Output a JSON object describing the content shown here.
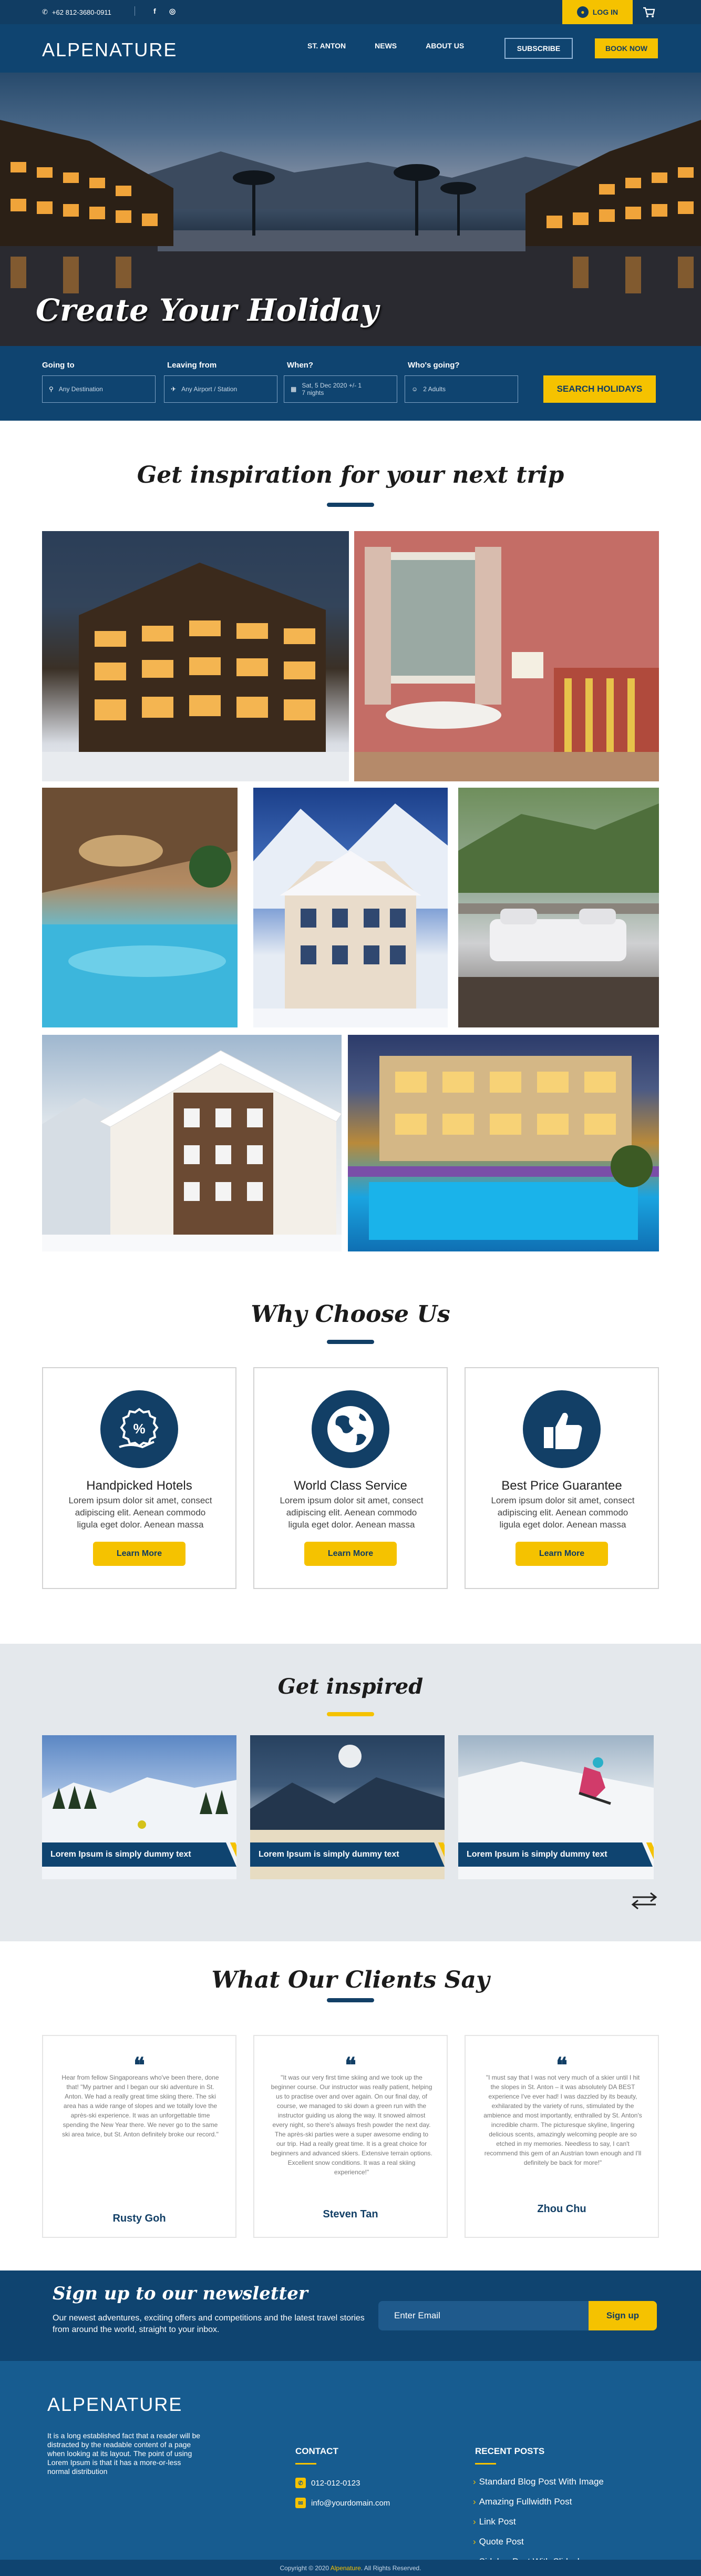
{
  "topbar": {
    "phone": "+62 812-3680-0911",
    "social": [
      "facebook-icon",
      "instagram-icon"
    ],
    "login_label": "LOG IN"
  },
  "header": {
    "logo": "ALPENATURE",
    "nav": [
      "ST. ANTON",
      "NEWS",
      "ABOUT US"
    ],
    "subscribe_label": "SUBSCRIBE",
    "book_label": "BOOK NOW"
  },
  "hero": {
    "title": "Create Your Holiday"
  },
  "search": {
    "going_to": {
      "label": "Going to",
      "placeholder": "Any Destination"
    },
    "leaving_from": {
      "label": "Leaving from",
      "placeholder": "Any Airport / Station"
    },
    "when": {
      "label": "When?",
      "line1": "Sat, 5 Dec 2020 +/- 1",
      "line2": "7 nights"
    },
    "who": {
      "label": "Who's going?",
      "value": "2 Adults"
    },
    "button": "SEARCH HOLIDAYS"
  },
  "inspiration": {
    "title": "Get inspiration for your next trip"
  },
  "why": {
    "title": "Why Choose Us",
    "cards": [
      {
        "title": "Handpicked Hotels",
        "text": "Lorem ipsum dolor sit amet, consect adipiscing elit. Aenean commodo ligula eget dolor. Aenean massa",
        "button": "Learn More",
        "icon": "percent-hand-icon"
      },
      {
        "title": "World Class Service",
        "text": "Lorem ipsum dolor sit amet, consect adipiscing elit. Aenean commodo ligula eget dolor. Aenean massa",
        "button": "Learn More",
        "icon": "globe-icon"
      },
      {
        "title": "Best Price Guarantee",
        "text": "Lorem ipsum dolor sit amet, consect adipiscing elit. Aenean commodo ligula eget dolor. Aenean massa",
        "button": "Learn More",
        "icon": "thumbs-up-icon"
      }
    ]
  },
  "inspired": {
    "title": "Get inspired",
    "cards": [
      {
        "caption": "Lorem Ipsum is simply dummy text"
      },
      {
        "caption": "Lorem Ipsum is simply dummy text"
      },
      {
        "caption": "Lorem Ipsum is simply dummy text"
      }
    ]
  },
  "testimonials": {
    "title": "What Our Clients Say",
    "items": [
      {
        "text": "Hear from fellow Singaporeans who've been there, done that! \"My partner and I began our ski adventure in St. Anton. We had a really great time skiing there. The ski area has a wide range of slopes and we totally love the après-ski experience. It was an unforgettable time spending the New Year there. We never go to the same ski area twice, but St. Anton definitely broke our record.\"",
        "name": "Rusty Goh"
      },
      {
        "text": "\"It was our very first time skiing and we took up the beginner course. Our instructor was really patient, helping us to practise over and over again. On our final day, of course, we managed to ski down a green run with the instructor guiding us along the way. It snowed almost every night, so there's always fresh powder the next day. The après-ski parties were a super awesome ending to our trip. Had a really great time. It is a great choice for beginners and advanced skiers. Extensive terrain options. Excellent snow conditions. It was a real skiing experience!\"",
        "name": "Steven Tan"
      },
      {
        "text": "\"I must say that I was not very much of a skier until I hit the slopes in St. Anton – it was absolutely DA BEST experience I've ever had! I was dazzled by its beauty, exhilarated by the variety of runs, stimulated by the ambience and most importantly, enthralled by St. Anton's incredible charm. The picturesque skyline, lingering delicious scents, amazingly welcoming people are so etched in my memories. Needless to say, I can't recommend this gem of an Austrian town enough and I'll definitely be back for more!\"",
        "name": "Zhou Chu"
      }
    ]
  },
  "newsletter": {
    "title": "Sign up to our newsletter",
    "text": "Our newest adventures, exciting offers and competitions and the latest travel stories from around the world, straight to your inbox.",
    "placeholder": "Enter Email",
    "button": "Sign up"
  },
  "footer": {
    "logo": "ALPENATURE",
    "about": "It is a long established fact that a reader will be distracted by the readable content of a page when looking at its layout. The point of using Lorem Ipsum is that it has a more-or-less normal distribution",
    "contact_title": "CONTACT",
    "phone": "012-012-0123",
    "email": "info@yourdomain.com",
    "posts_title": "RECENT POSTS",
    "posts": [
      "Standard Blog Post With Image",
      "Amazing Fullwidth Post",
      "Link Post",
      "Quote Post",
      "Sidebar Post With Slideshow"
    ],
    "copyright_prefix": "Copyright © 2020",
    "copyright_brand": "Alpenature",
    "copyright_suffix": ". All Rights Reserved."
  },
  "colors": {
    "navy": "#0f4470",
    "accent": "#f5c200"
  }
}
